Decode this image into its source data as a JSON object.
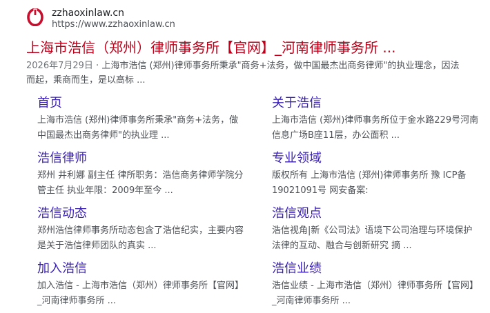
{
  "site": {
    "name": "zzhaoxinlaw.cn",
    "url": "https://www.zzhaoxinlaw.cn"
  },
  "result": {
    "title": "上海市浩信（郑州）律师事务所【官网】_河南律师事务所 ...",
    "date": "2026年7月29日",
    "separator": "·",
    "snippet": "上海市浩信 (郑州)律师事务所秉承\"商务+法务，做中国最杰出商务律师\"的执业理念，因法而起，乘商而生，是以高标 ..."
  },
  "sitelinks": [
    {
      "title": "首页",
      "desc": "上海市浩信 (郑州)律师事务所秉承\"商务+法务，做中国最杰出商务律师\"的执业理 ..."
    },
    {
      "title": "关于浩信",
      "desc": "上海市浩信 (郑州)律师事务所位于金水路229号河南信息广场B座11层，办公面积 ..."
    },
    {
      "title": "浩信律师",
      "desc": "郑州 井利娜 副主任 律所职务：浩信商务律师学院分管主任 执业年限：2009年至今 ..."
    },
    {
      "title": "专业领域",
      "desc": "版权所有 上海市浩信 (郑州)律师事务所 豫 ICP备19021091号 网安备案:"
    },
    {
      "title": "浩信动态",
      "desc": "郑州浩信律师事务所动态包含了浩信纪实，主要内容是关于浩信律师团队的真实 ..."
    },
    {
      "title": "浩信观点",
      "desc": "浩信视角|新《公司法》语境下公司治理与环境保护法律的互动、融合与创新研究 摘 ..."
    },
    {
      "title": "加入浩信",
      "desc": "加入浩信 - 上海市浩信（郑州）律师事务所【官网】_河南律师事务所 ..."
    },
    {
      "title": "浩信业绩",
      "desc": "浩信业绩 - 上海市浩信（郑州）律师事务所【官网】_河南律师事务所 ..."
    }
  ],
  "colors": {
    "title": "#c0001a",
    "sitelink": "#3a1fb5",
    "text": "#4d5156",
    "favicon": "#c8102e"
  },
  "icons": {
    "favicon": "site-logo-icon"
  }
}
